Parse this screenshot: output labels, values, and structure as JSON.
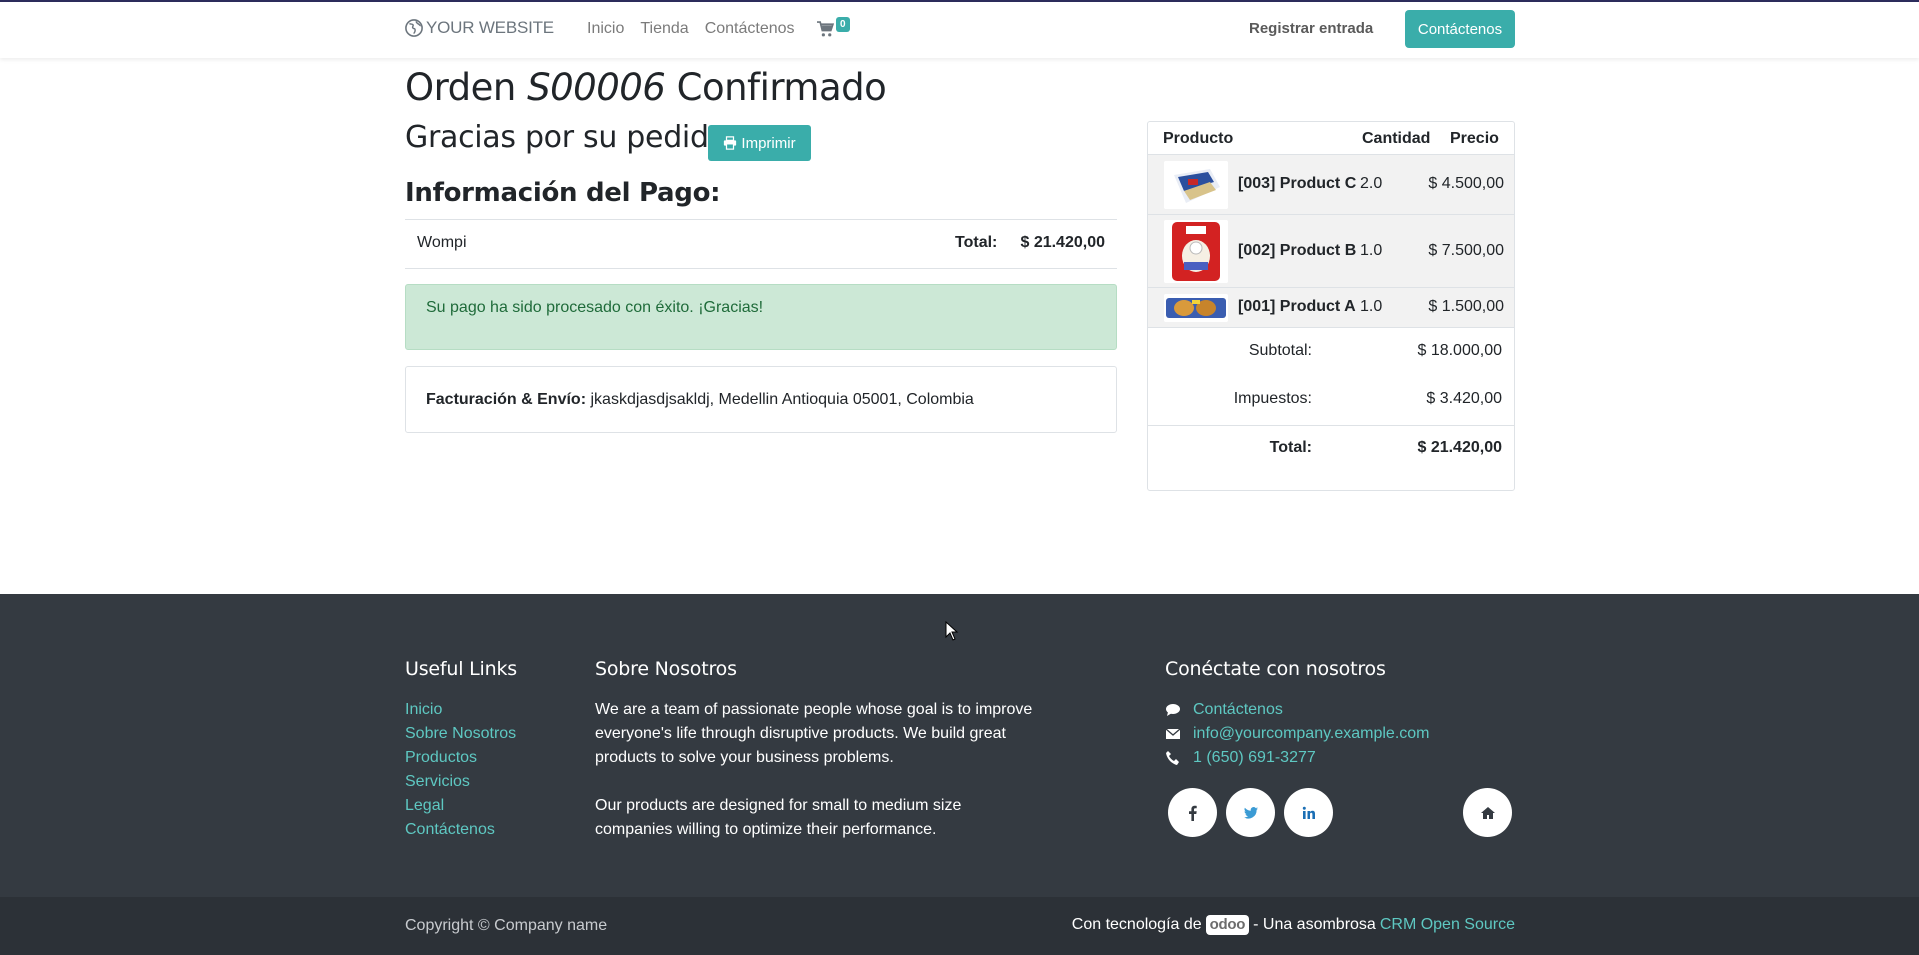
{
  "header": {
    "brand": "YOUR WEBSITE",
    "nav": [
      "Inicio",
      "Tienda",
      "Contáctenos"
    ],
    "cart_count": "0",
    "signin": "Registrar entrada",
    "contact_button": "Contáctenos"
  },
  "order": {
    "title_prefix": "Orden",
    "order_number": "S00006",
    "title_suffix": "Confirmado",
    "thanks": "Gracias por su pedido.",
    "print_label": "Imprimir",
    "payment_title": "Información del Pago:",
    "payment_method": "Wompi",
    "total_label": "Total:",
    "total_value": "$ 21.420,00",
    "success_message": "Su pago ha sido procesado con éxito. ¡Gracias!",
    "address_label": "Facturación & Envío:",
    "address_value": "jkaskdjasdjsakldj, Medellin Antioquia 05001, Colombia"
  },
  "summary": {
    "headers": {
      "product": "Producto",
      "quantity": "Cantidad",
      "price": "Precio"
    },
    "items": [
      {
        "name": "[003] Product C",
        "qty": "2.0",
        "price": "$ 4.500,00"
      },
      {
        "name": "[002] Product B",
        "qty": "1.0",
        "price": "$ 7.500,00"
      },
      {
        "name": "[001] Product A",
        "qty": "1.0",
        "price": "$ 1.500,00"
      }
    ],
    "subtotal_label": "Subtotal:",
    "subtotal_value": "$ 18.000,00",
    "taxes_label": "Impuestos:",
    "taxes_value": "$ 3.420,00",
    "total_label": "Total:",
    "total_value": "$ 21.420,00"
  },
  "footer": {
    "useful_title": "Useful Links",
    "useful_links": [
      "Inicio",
      "Sobre Nosotros",
      "Productos",
      "Servicios",
      "Legal",
      "Contáctenos"
    ],
    "about_title": "Sobre Nosotros",
    "about_p1": "We are a team of passionate people whose goal is to improve everyone's life through disruptive products. We build great products to solve your business problems.",
    "about_p2": "Our products are designed for small to medium size companies willing to optimize their performance.",
    "connect_title": "Conéctate con nosotros",
    "contact_link": "Contáctenos",
    "email": "info@yourcompany.example.com",
    "phone": "1 (650) 691-3277",
    "copyright": "Copyright © Company name",
    "powered_prefix": "Con tecnología de",
    "odoo": "odoo",
    "powered_middle": "- Una asombrosa",
    "powered_link": "CRM Open Source"
  },
  "colors": {
    "accent": "#3aadaa",
    "footer_bg": "#343a41",
    "link": "#5ec8c2",
    "success_bg": "#cce8d6"
  }
}
